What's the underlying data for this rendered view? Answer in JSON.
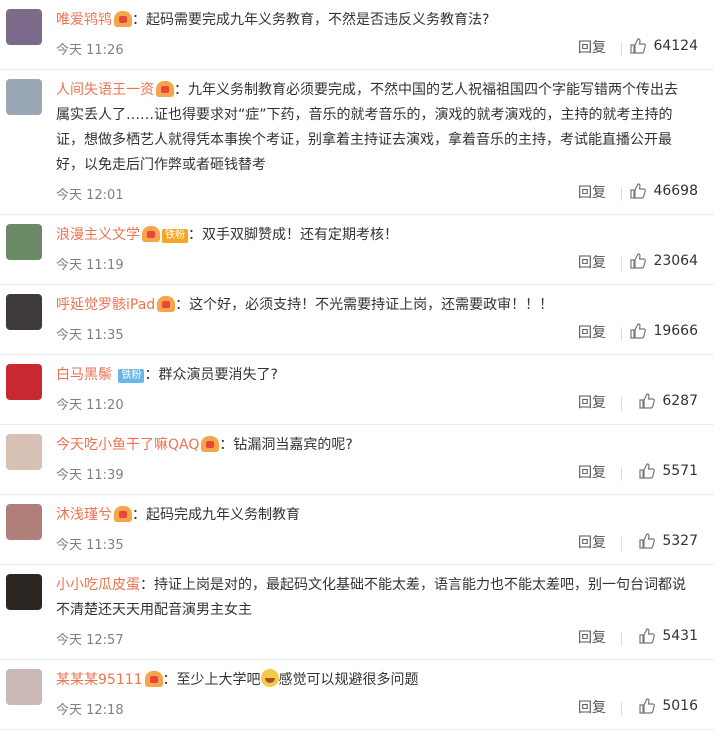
{
  "reply_label": "回复",
  "comments": [
    {
      "user": "唯爱鸨鸨",
      "badge": "vip",
      "fan": "",
      "text": "：起码需要完成九年义务教育，不然是否违反义务教育法?",
      "time": "今天 11:26",
      "likes": "64124",
      "avatar_color": "#7b6a8a"
    },
    {
      "user": "人间失语王一资",
      "badge": "vip",
      "fan": "",
      "text": "：九年义务制教育必须要完成，不然中国的艺人祝福祖国四个字能写错两个传出去属实丢人了……证也得要求对“症”下药，音乐的就考音乐的，演戏的就考演戏的，主持的就考主持的证，想做多栖艺人就得凭本事挨个考证，别拿着主持证去演戏，拿着音乐的主持，考试能直播公开最好，以免走后门作弊或者砸钱替考",
      "time": "今天 12:01",
      "likes": "46698",
      "avatar_color": "#9aa7b5"
    },
    {
      "user": "浪漫主义文学",
      "badge": "vip",
      "fan": "铁粉",
      "fan_style": "orange",
      "text": "：双手双脚赞成！还有定期考核！",
      "time": "今天 11:19",
      "likes": "23064",
      "avatar_color": "#6a8a66"
    },
    {
      "user": "呼延觉罗骸iPad",
      "badge": "vip",
      "fan": "",
      "text": "：这个好，必须支持！不光需要持证上岗，还需要政审！！！",
      "time": "今天 11:35",
      "likes": "19666",
      "avatar_color": "#3f3a3a"
    },
    {
      "user": "白马黑鬃",
      "badge": "",
      "fan": "铁粉",
      "fan_style": "blue",
      "text": "：群众演员要消失了?",
      "time": "今天 11:20",
      "likes": "6287",
      "avatar_color": "#c8282f"
    },
    {
      "user": "今天吃小鱼干了嘛QAQ",
      "badge": "vip",
      "fan": "",
      "text": "：钻漏洞当嘉宾的呢?",
      "time": "今天 11:39",
      "likes": "5571",
      "avatar_color": "#d7c1b5"
    },
    {
      "user": "沐浅瑾兮",
      "badge": "vip",
      "fan": "",
      "text": "：起码完成九年义务制教育",
      "time": "今天 11:35",
      "likes": "5327",
      "avatar_color": "#b07f7a"
    },
    {
      "user": "小小吃瓜皮蛋",
      "badge": "",
      "fan": "",
      "text": "：持证上岗是对的，最起码文化基础不能太差，语言能力也不能太差吧，别一句台词都说不清楚还天天用配音演男主女主",
      "time": "今天 12:57",
      "likes": "5431",
      "avatar_color": "#2c2622"
    },
    {
      "user": "某某某95111",
      "badge": "vip",
      "fan": "",
      "text_before": "：至少上大学吧",
      "emoji": "laugh",
      "text_after": "感觉可以规避很多问题",
      "time": "今天 12:18",
      "likes": "5016",
      "avatar_color": "#c9b8b6"
    }
  ]
}
